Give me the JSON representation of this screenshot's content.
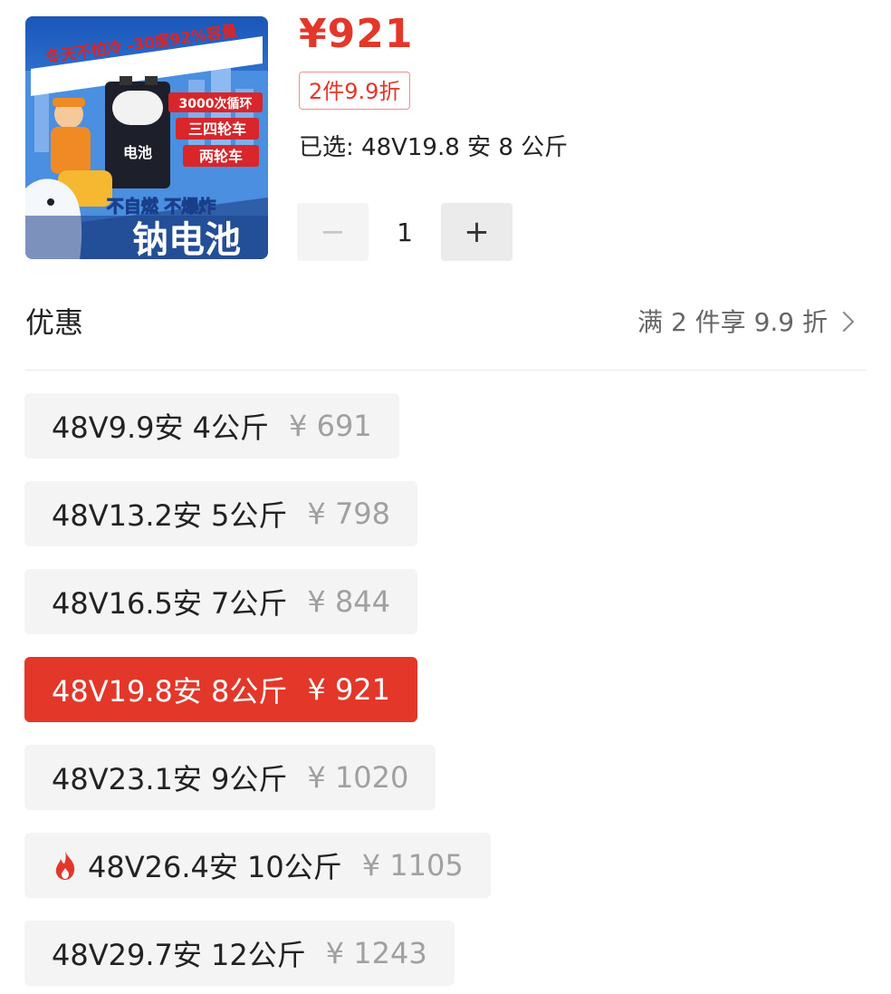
{
  "product": {
    "image_texts": {
      "line1": "冬天不怕冷 -30度92%容量",
      "badge1": "3000次循环",
      "badge2": "三四轮车",
      "badge3": "两轮车",
      "battery_label": "电池",
      "slogan": "不自燃 不爆炸",
      "big_title": "钠电池"
    },
    "price": "¥921",
    "discount_tag": "2件9.9折",
    "selected_text": "已选: 48V19.8 安 8 公斤"
  },
  "stepper": {
    "minus": "−",
    "quantity": "1",
    "plus": "+"
  },
  "promo": {
    "label": "优惠",
    "value": "满 2 件享 9.9 折"
  },
  "options": [
    {
      "label": "48V9.9安 4公斤",
      "price": "¥ 691",
      "selected": false,
      "hot": false
    },
    {
      "label": "48V13.2安 5公斤",
      "price": "¥ 798",
      "selected": false,
      "hot": false
    },
    {
      "label": "48V16.5安 7公斤",
      "price": "¥ 844",
      "selected": false,
      "hot": false
    },
    {
      "label": "48V19.8安 8公斤",
      "price": "¥ 921",
      "selected": true,
      "hot": false
    },
    {
      "label": "48V23.1安 9公斤",
      "price": "¥ 1020",
      "selected": false,
      "hot": false
    },
    {
      "label": "48V26.4安 10公斤",
      "price": "¥ 1105",
      "selected": false,
      "hot": true
    },
    {
      "label": "48V29.7安 12公斤",
      "price": "¥ 1243",
      "selected": false,
      "hot": false
    }
  ],
  "colors": {
    "accent": "#e3372a",
    "chip_bg": "#f4f4f4",
    "muted_price": "#a0a0a0"
  }
}
